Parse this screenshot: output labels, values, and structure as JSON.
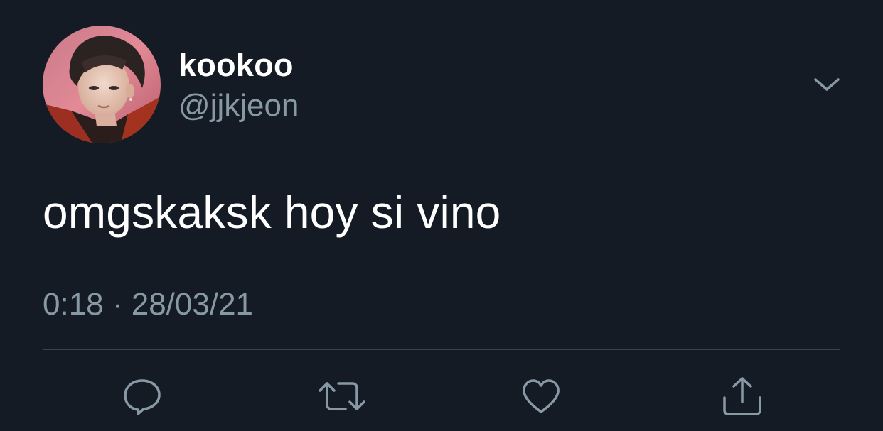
{
  "tweet": {
    "display_name": "kookoo",
    "handle": "@jjkjeon",
    "text": "omgskaksk hoy si vino",
    "timestamp": "0:18 · 28/03/21"
  },
  "icons": {
    "avatar": "profile-photo",
    "menu": "chevron-down-icon",
    "reply": "comment-icon",
    "retweet": "retweet-icon",
    "like": "heart-icon",
    "share": "share-icon"
  },
  "colors": {
    "background": "#151b25",
    "primary_text": "#ffffff",
    "secondary_text": "#8899a6",
    "divider": "#38444d"
  }
}
